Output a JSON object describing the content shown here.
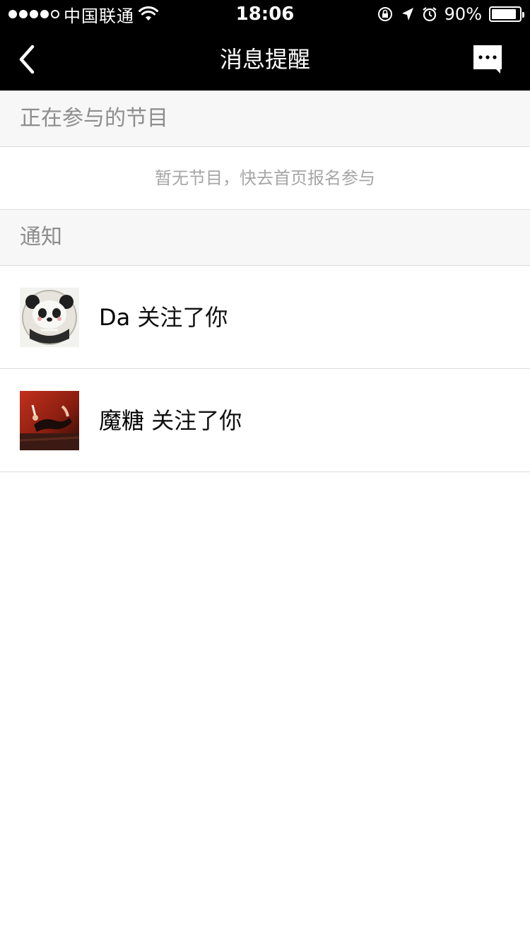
{
  "status_bar": {
    "carrier": "中国联通",
    "time": "18:06",
    "battery": "90%",
    "signal_bars_filled": 4,
    "signal_bars_total": 5,
    "battery_level": 0.9
  },
  "nav": {
    "title": "消息提醒",
    "back_icon": "chevron-left-icon",
    "message_icon": "chat-bubble-icon"
  },
  "sections": {
    "participating": {
      "header": "正在参与的节目",
      "empty_text": "暂无节目，快去首页报名参与"
    },
    "notifications": {
      "header": "通知",
      "items": [
        {
          "name": "Da",
          "action": "关注了你",
          "avatar": "panda-avatar"
        },
        {
          "name": "魔糖",
          "action": "关注了你",
          "avatar": "photo-avatar"
        }
      ]
    }
  },
  "colors": {
    "nav_bg": "#000000",
    "section_bg": "#f7f7f7",
    "divider": "#dddddd",
    "muted_text": "#8d8d8d"
  }
}
